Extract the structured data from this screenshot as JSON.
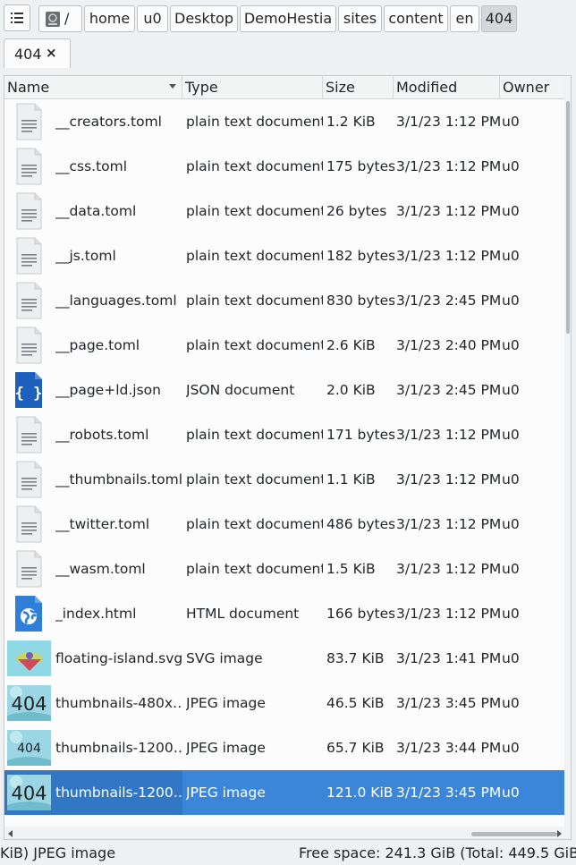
{
  "pathbar": {
    "root_label": "/",
    "crumbs": [
      "home",
      "u0",
      "Desktop",
      "DemoHestia",
      "sites",
      "content",
      "en",
      "404"
    ]
  },
  "tab": {
    "label": "404",
    "close_glyph": "×"
  },
  "columns": {
    "name": "Name",
    "type": "Type",
    "size": "Size",
    "modified": "Modified",
    "owner": "Owner"
  },
  "files": [
    {
      "name": "__creators.toml",
      "type": "plain text document",
      "size": "1.2 KiB",
      "modified": "3/1/23 1:12 PM",
      "owner": "u0",
      "icon": "text-file-icon"
    },
    {
      "name": "__css.toml",
      "type": "plain text document",
      "size": "175 bytes",
      "modified": "3/1/23 1:12 PM",
      "owner": "u0",
      "icon": "text-file-icon"
    },
    {
      "name": "__data.toml",
      "type": "plain text document",
      "size": "26 bytes",
      "modified": "3/1/23 1:12 PM",
      "owner": "u0",
      "icon": "text-file-icon"
    },
    {
      "name": "__js.toml",
      "type": "plain text document",
      "size": "182 bytes",
      "modified": "3/1/23 1:12 PM",
      "owner": "u0",
      "icon": "text-file-icon"
    },
    {
      "name": "__languages.toml",
      "type": "plain text document",
      "size": "830 bytes",
      "modified": "3/1/23 2:45 PM",
      "owner": "u0",
      "icon": "text-file-icon"
    },
    {
      "name": "__page.toml",
      "type": "plain text document",
      "size": "2.6 KiB",
      "modified": "3/1/23 2:40 PM",
      "owner": "u0",
      "icon": "text-file-icon"
    },
    {
      "name": "__page+ld.json",
      "type": "JSON document",
      "size": "2.0 KiB",
      "modified": "3/1/23 2:45 PM",
      "owner": "u0",
      "icon": "json-file-icon"
    },
    {
      "name": "__robots.toml",
      "type": "plain text document",
      "size": "171 bytes",
      "modified": "3/1/23 1:12 PM",
      "owner": "u0",
      "icon": "text-file-icon"
    },
    {
      "name": "__thumbnails.toml",
      "type": "plain text document",
      "size": "1.1 KiB",
      "modified": "3/1/23 1:12 PM",
      "owner": "u0",
      "icon": "text-file-icon"
    },
    {
      "name": "__twitter.toml",
      "type": "plain text document",
      "size": "486 bytes",
      "modified": "3/1/23 1:12 PM",
      "owner": "u0",
      "icon": "text-file-icon"
    },
    {
      "name": "__wasm.toml",
      "type": "plain text document",
      "size": "1.5 KiB",
      "modified": "3/1/23 1:12 PM",
      "owner": "u0",
      "icon": "text-file-icon"
    },
    {
      "name": "_index.html",
      "type": "HTML document",
      "size": "166 bytes",
      "modified": "3/1/23 1:12 PM",
      "owner": "u0",
      "icon": "html-file-icon"
    },
    {
      "name": "floating-island.svg",
      "type": "SVG image",
      "size": "83.7 KiB",
      "modified": "3/1/23 1:41 PM",
      "owner": "u0",
      "icon": "svg-thumbnail"
    },
    {
      "name": "thumbnails-480x…",
      "type": "JPEG image",
      "size": "46.5 KiB",
      "modified": "3/1/23 3:45 PM",
      "owner": "u0",
      "icon": "jpeg-thumbnail",
      "thumb_text": "404"
    },
    {
      "name": "thumbnails-1200…",
      "type": "JPEG image",
      "size": "65.7 KiB",
      "modified": "3/1/23 3:44 PM",
      "owner": "u0",
      "icon": "jpeg-thumbnail",
      "thumb_text": "404"
    },
    {
      "name": "thumbnails-1200…",
      "type": "JPEG image",
      "size": "121.0 KiB",
      "modified": "3/1/23 3:45 PM",
      "owner": "u0",
      "icon": "jpeg-thumbnail",
      "thumb_text": "404",
      "selected": true
    }
  ],
  "status": {
    "left": "KiB) JPEG image",
    "right": "Free space: 241.3 GiB (Total: 449.5 GiB)"
  },
  "colors": {
    "selection": "#3b86d9",
    "json_icon": "#1d5fbd",
    "html_icon": "#2f7fd8"
  }
}
